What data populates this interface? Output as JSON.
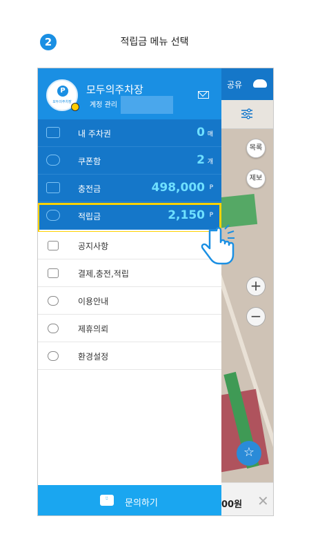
{
  "step": {
    "number": "2",
    "title": "적립금 메뉴 선택"
  },
  "drawer": {
    "user_name": "모두의주차장",
    "account_link": "계정 관리",
    "avatar_logo": "P",
    "avatar_text": "모두의주차장",
    "menu_top": [
      {
        "label": "내 주차권",
        "value": "0",
        "unit": "매",
        "icon": "ticket-icon"
      },
      {
        "label": "쿠폰함",
        "value": "2",
        "unit": "개",
        "icon": "coupon-icon"
      },
      {
        "label": "충전금",
        "value": "498,000",
        "unit": "P",
        "icon": "coins-icon"
      },
      {
        "label": "적립금",
        "value": "2,150",
        "unit": "P",
        "icon": "reward-icon"
      }
    ],
    "menu_bottom": [
      {
        "label": "공지사항",
        "icon": "megaphone-icon"
      },
      {
        "label": "결제,충전,적립",
        "icon": "wallet-icon"
      },
      {
        "label": "이용안내",
        "icon": "headset-icon"
      },
      {
        "label": "제휴의뢰",
        "icon": "handshake-icon"
      },
      {
        "label": "환경설정",
        "icon": "gear-icon"
      }
    ],
    "cta_label": "문의하기"
  },
  "map": {
    "share_label": "공유",
    "list_button": "목록",
    "report_button": "제보",
    "zoom_in": "+",
    "zoom_out": "−",
    "bottom_text": "00원",
    "close": "✕"
  },
  "colors": {
    "header": "#1a8fe3",
    "menu_blue": "#1577c9",
    "highlight": "#ffd200",
    "value": "#6fe0ff",
    "cta": "#1aa6f0"
  }
}
